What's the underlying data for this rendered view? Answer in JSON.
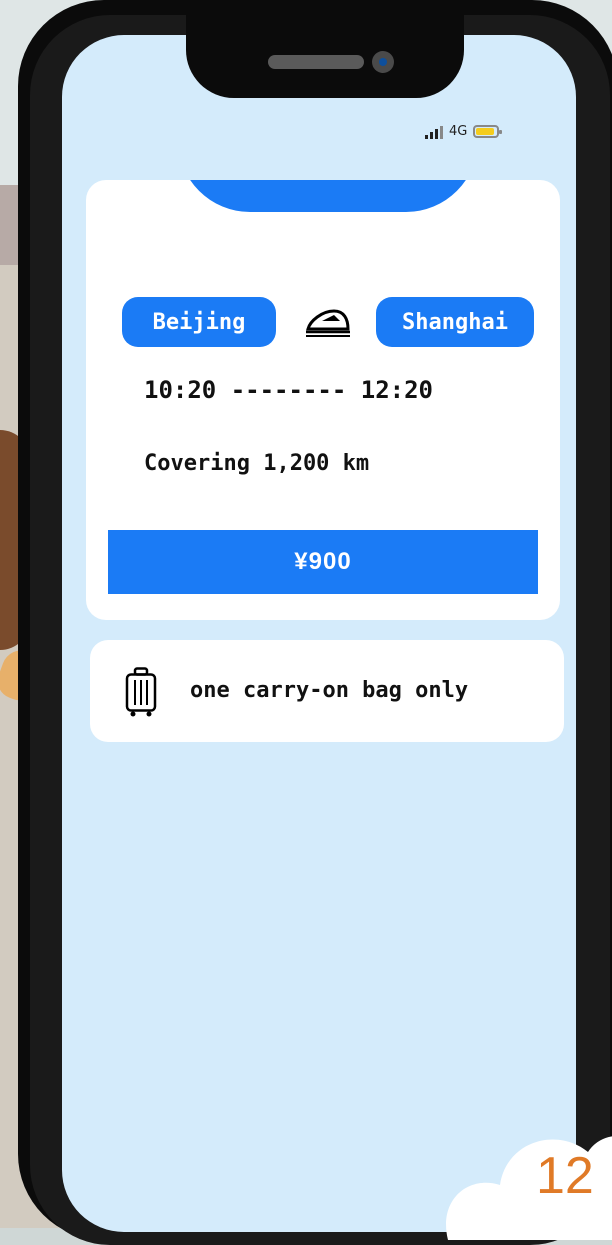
{
  "status_bar": {
    "network": "4G",
    "battery_color": "#f4cc1c",
    "signal_icon": "signal-bars-icon"
  },
  "ticket": {
    "from": "Beijing",
    "to": "Shanghai",
    "transport_icon": "high-speed-train-icon",
    "departure_time": "10:20",
    "separator": "--------",
    "arrival_time": "12:20",
    "distance": "Covering 1,200 km",
    "price": "¥900"
  },
  "baggage": {
    "icon": "luggage-icon",
    "text": "one carry-on bag only"
  },
  "page_number": "12",
  "colors": {
    "accent": "#1b7bf5",
    "screen_background": "#d4ebfb",
    "page_number": "#e07a27"
  }
}
